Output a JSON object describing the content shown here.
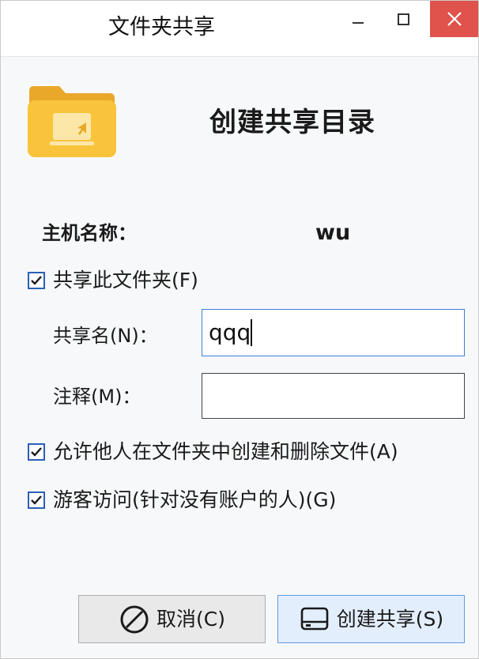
{
  "window": {
    "title": "文件夹共享"
  },
  "header": {
    "heading": "创建共享目录",
    "folder_icon": "folder-share-icon"
  },
  "host": {
    "label": "主机名称：",
    "value": "wu"
  },
  "share_folder": {
    "label": "共享此文件夹(F)",
    "checked": true
  },
  "share_name": {
    "label": "共享名(N)：",
    "value": "qqq"
  },
  "comment": {
    "label": "注释(M)：",
    "value": ""
  },
  "allow_create_delete": {
    "label": "允许他人在文件夹中创建和删除文件(A)",
    "checked": true
  },
  "guest_access": {
    "label": "游客访问(针对没有账户的人)(G)",
    "checked": true
  },
  "buttons": {
    "cancel_label": "取消(C)",
    "create_label": "创建共享(S)"
  },
  "colors": {
    "folder_yellow": "#f9c33c",
    "checkbox_blue": "#2b5fb5",
    "close_red": "#e0524c",
    "focus_blue": "#3d7fd6"
  }
}
